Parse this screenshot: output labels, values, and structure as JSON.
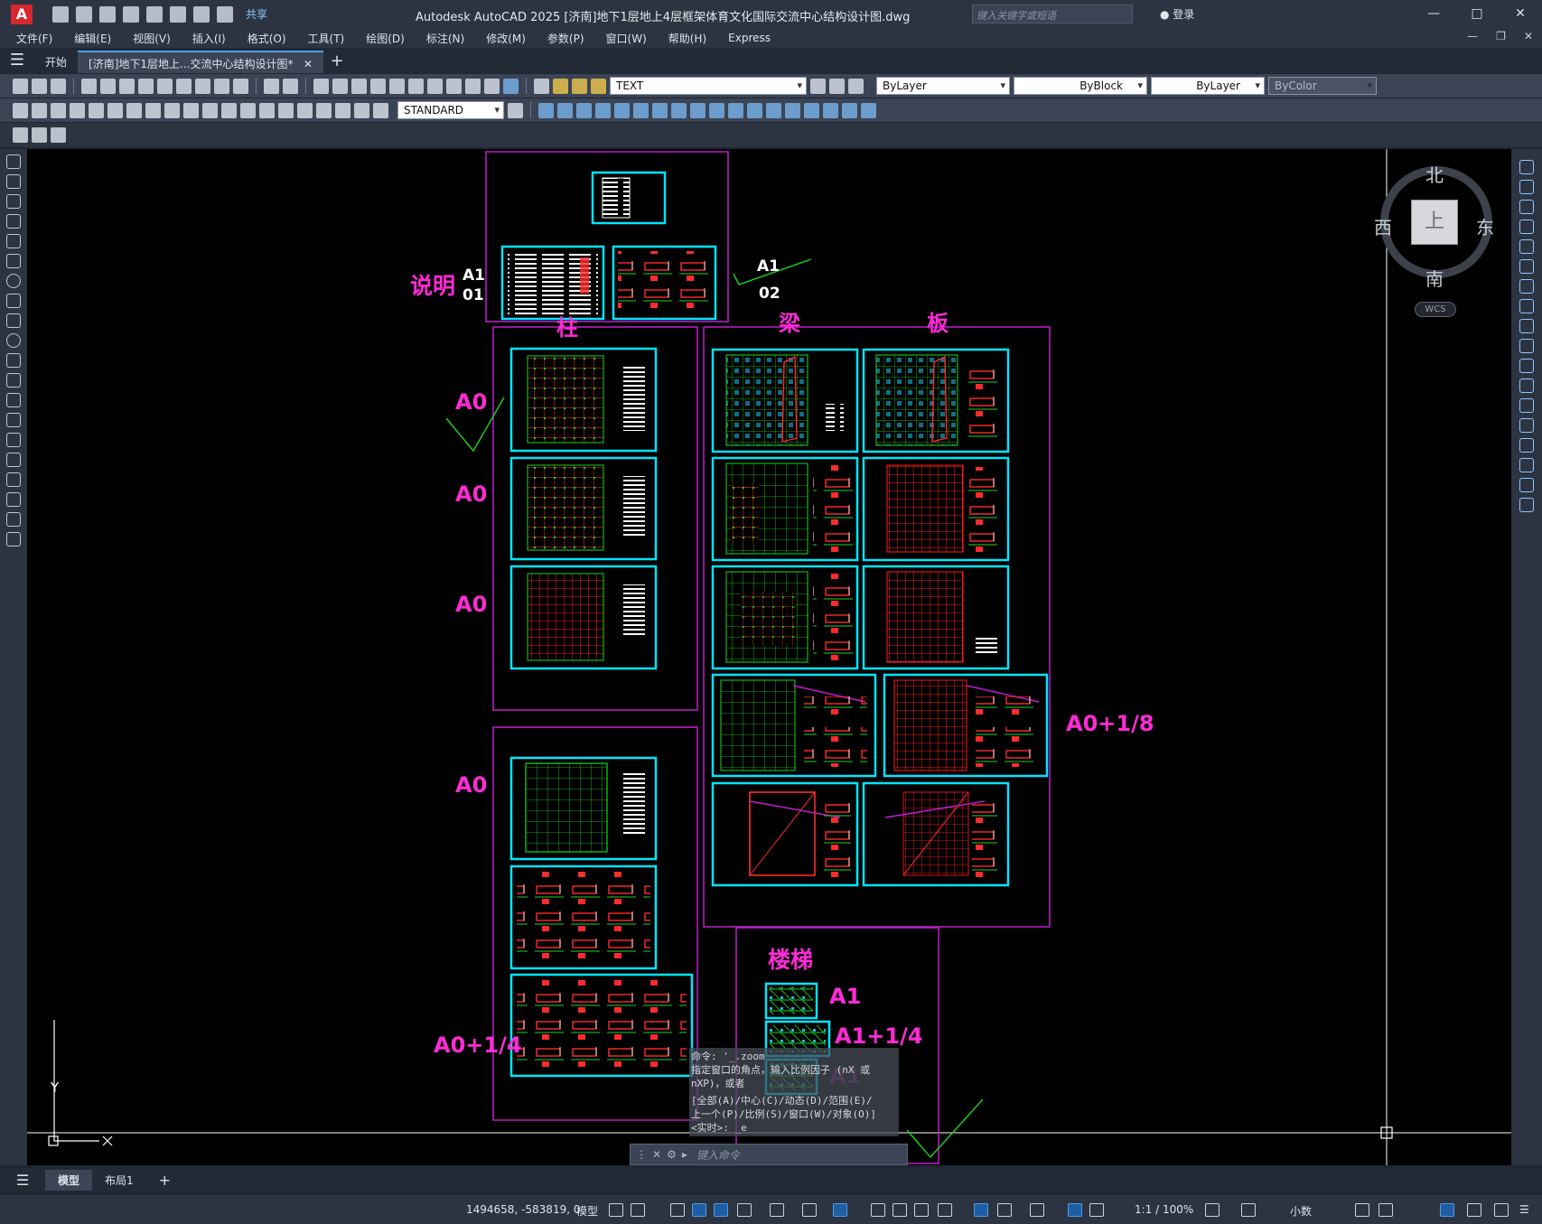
{
  "titlebar": {
    "app_letter": "A",
    "share_label": "共享",
    "title": "Autodesk AutoCAD 2025    [济南]地下1层地上4层框架体育文化国际交流中心结构设计图.dwg",
    "search_placeholder": "键入关键字或短语",
    "login_label": "登录"
  },
  "menu": [
    "文件(F)",
    "编辑(E)",
    "视图(V)",
    "插入(I)",
    "格式(O)",
    "工具(T)",
    "绘图(D)",
    "标注(N)",
    "修改(M)",
    "参数(P)",
    "窗口(W)",
    "帮助(H)",
    "Express"
  ],
  "tabs": {
    "start": "开始",
    "doc": "[济南]地下1层地上...交流中心结构设计图*"
  },
  "toolbar": {
    "text_style": "TEXT",
    "dim_style": "STANDARD",
    "layer": "ByLayer",
    "linetype": "ByBlock",
    "lineweight": "ByLayer",
    "color": "ByColor"
  },
  "drawing": {
    "labels": {
      "shuoming": "说明",
      "zhu": "柱",
      "liang": "梁",
      "ban": "板",
      "louti": "楼梯",
      "a0_1": "A0",
      "a0_2": "A0",
      "a0_3": "A0",
      "a0_4": "A0",
      "a0_quarter": "A0+1/4",
      "a0_eighth": "A0+1/8",
      "a1_stair": "A1",
      "a1_quarter_stair": "A1+1/4",
      "a1_stair2": "A1"
    },
    "white_labels": {
      "a1_top": "A1",
      "n01": "01",
      "a1_right": "A1",
      "n02": "02"
    },
    "ucs": {
      "y": "Y",
      "x": "X"
    }
  },
  "viewcube": {
    "north": "北",
    "south": "南",
    "east": "东",
    "west": "西",
    "face": "上",
    "wcs": "WCS"
  },
  "command": {
    "history": [
      "命令: '_.zoom",
      "指定窗口的角点，输入比例因子 (nX 或",
      "nXP)，或者",
      "[全部(A)/中心(C)/动态(D)/范围(E)/",
      "上一个(P)/比例(S)/窗口(W)/对象(O)]",
      "<实时>: _e"
    ],
    "placeholder": "键入命令"
  },
  "layout_tabs": {
    "model": "模型",
    "layout1": "布局1"
  },
  "status": {
    "coords": "1494658, -583819, 0",
    "model": "模型",
    "scale": "1:1 / 100%",
    "units": "小数"
  },
  "colors": {
    "cad_background": "#000000",
    "sheet_frame": "#00e5ff",
    "group_frame": "#c21bd0",
    "label_magenta": "#ff2bd6",
    "annotation_green": "#16d71c",
    "grid_red": "#ff1a1a"
  }
}
